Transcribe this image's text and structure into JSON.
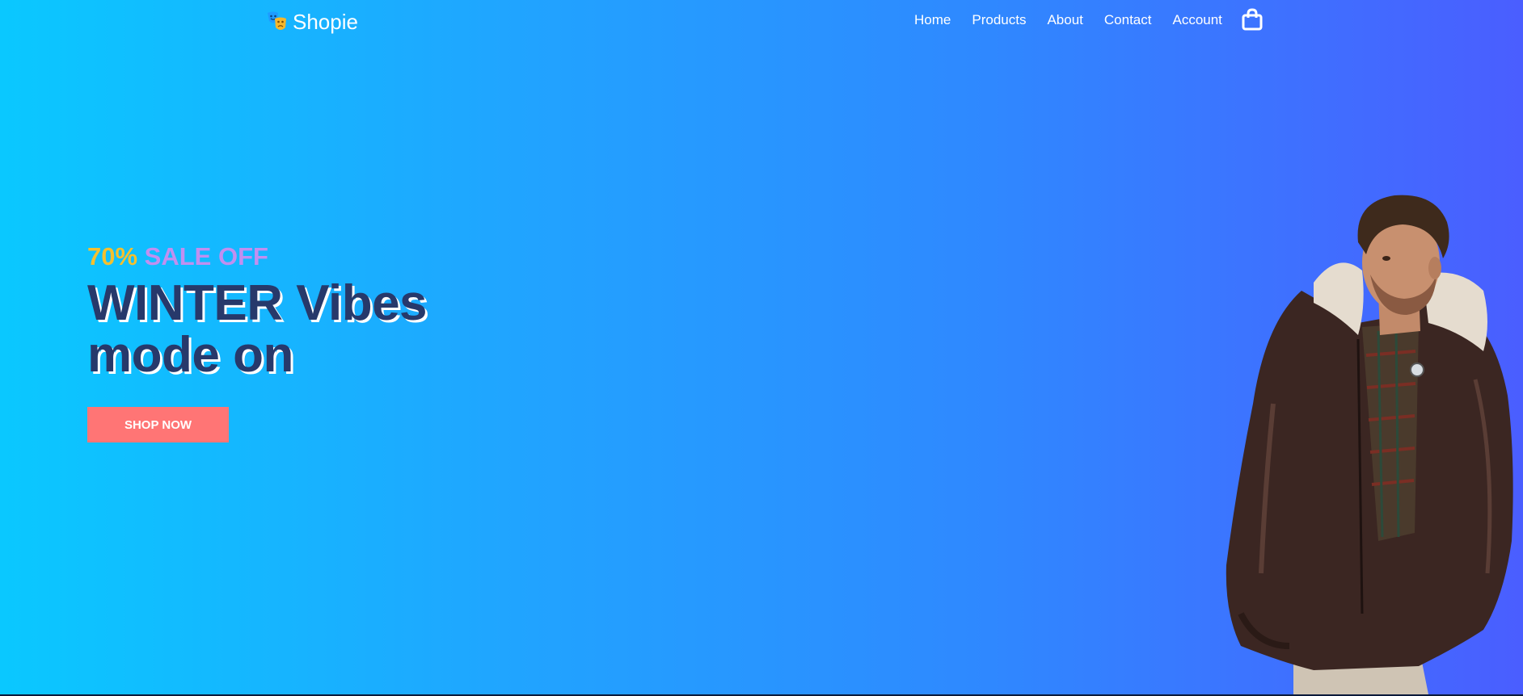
{
  "brand": {
    "name": "Shopie",
    "logo_icon": "masks-icon"
  },
  "nav": {
    "items": [
      {
        "label": "Home"
      },
      {
        "label": "Products"
      },
      {
        "label": "About"
      },
      {
        "label": "Contact"
      },
      {
        "label": "Account"
      }
    ],
    "cart_icon": "shopping-bag-icon"
  },
  "hero": {
    "promo_percent": "70%",
    "promo_text": "SALE OFF",
    "headline_line1": "WINTER Vibes",
    "headline_line2": "mode on",
    "cta_label": "SHOP NOW"
  },
  "colors": {
    "gradient_start": "#0ac8ff",
    "gradient_end": "#4a5eff",
    "promo_percent": "#f5c02e",
    "promo_text": "#c18ff0",
    "headline": "#27396b",
    "cta_background": "#ff7575"
  }
}
